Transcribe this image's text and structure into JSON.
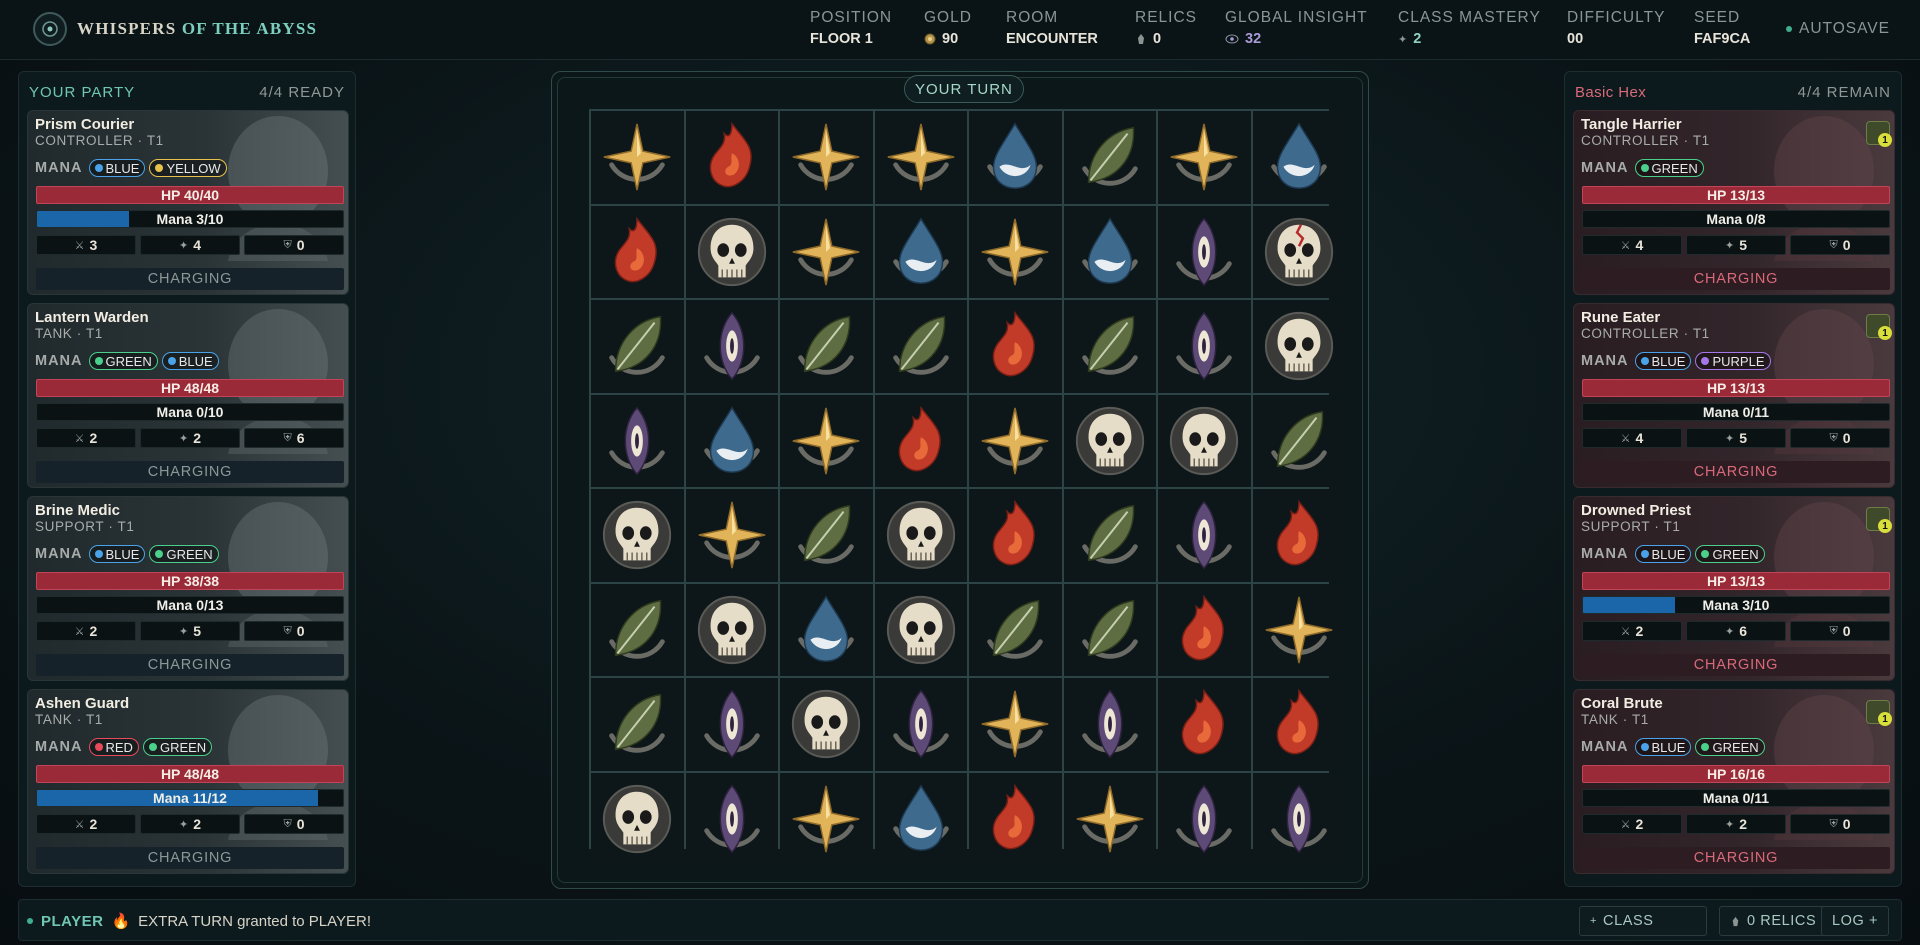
{
  "topbar": {
    "title_main": "WHISPERS",
    "title_accent": "OF THE ABYSS",
    "stats": [
      {
        "label": "POSITION",
        "value": "FLOOR 1"
      },
      {
        "label": "GOLD",
        "value": "90",
        "icon": "coin-icon"
      },
      {
        "label": "ROOM",
        "value": "ENCOUNTER"
      },
      {
        "label": "RELICS",
        "value": "0",
        "icon": "relic-icon"
      },
      {
        "label": "GLOBAL INSIGHT",
        "value": "32",
        "icon": "eye-icon"
      },
      {
        "label": "CLASS MASTERY",
        "value": "2",
        "icon": "mastery-icon"
      },
      {
        "label": "DIFFICULTY",
        "value": "00"
      },
      {
        "label": "SEED",
        "value": "FAF9CA"
      }
    ],
    "autosave": "AUTOSAVE"
  },
  "party": {
    "title": "YOUR PARTY",
    "status": "4/4 READY",
    "members": [
      {
        "name": "Prism Courier",
        "class": "CONTROLLER · T1",
        "mana_label": "MANA",
        "colors": [
          "BLUE",
          "YELLOW"
        ],
        "hp": "HP 40/40",
        "mana": "Mana 3/10",
        "mana_fraction": 0.3,
        "attack": "3",
        "magic": "4",
        "defense": "0",
        "charge": "CHARGING"
      },
      {
        "name": "Lantern Warden",
        "class": "TANK · T1",
        "mana_label": "MANA",
        "colors": [
          "GREEN",
          "BLUE"
        ],
        "hp": "HP 48/48",
        "mana": "Mana 0/10",
        "mana_fraction": 0,
        "attack": "2",
        "magic": "2",
        "defense": "6",
        "charge": "CHARGING"
      },
      {
        "name": "Brine Medic",
        "class": "SUPPORT · T1",
        "mana_label": "MANA",
        "colors": [
          "BLUE",
          "GREEN"
        ],
        "hp": "HP 38/38",
        "mana": "Mana 0/13",
        "mana_fraction": 0,
        "attack": "2",
        "magic": "5",
        "defense": "0",
        "charge": "CHARGING"
      },
      {
        "name": "Ashen Guard",
        "class": "TANK · T1",
        "mana_label": "MANA",
        "colors": [
          "RED",
          "GREEN"
        ],
        "hp": "HP 48/48",
        "mana": "Mana 11/12",
        "mana_fraction": 0.9167,
        "attack": "2",
        "magic": "2",
        "defense": "0",
        "charge": "CHARGING"
      }
    ]
  },
  "enemies": {
    "title": "Basic Hex",
    "status": "4/4 REMAIN",
    "members": [
      {
        "name": "Tangle Harrier",
        "class": "CONTROLLER · T1",
        "mana_label": "MANA",
        "colors": [
          "GREEN"
        ],
        "hp": "HP 13/13",
        "mana": "Mana 0/8",
        "mana_fraction": 0,
        "attack": "4",
        "magic": "5",
        "defense": "0",
        "charge": "CHARGING",
        "badge": "1"
      },
      {
        "name": "Rune Eater",
        "class": "CONTROLLER · T1",
        "mana_label": "MANA",
        "colors": [
          "BLUE",
          "PURPLE"
        ],
        "hp": "HP 13/13",
        "mana": "Mana 0/11",
        "mana_fraction": 0,
        "attack": "4",
        "magic": "5",
        "defense": "0",
        "charge": "CHARGING",
        "badge": "1"
      },
      {
        "name": "Drowned Priest",
        "class": "SUPPORT · T1",
        "mana_label": "MANA",
        "colors": [
          "BLUE",
          "GREEN"
        ],
        "hp": "HP 13/13",
        "mana": "Mana 3/10",
        "mana_fraction": 0.3,
        "attack": "2",
        "magic": "6",
        "defense": "0",
        "charge": "CHARGING",
        "badge": "1"
      },
      {
        "name": "Coral Brute",
        "class": "TANK · T1",
        "mana_label": "MANA",
        "colors": [
          "BLUE",
          "GREEN"
        ],
        "hp": "HP 16/16",
        "mana": "Mana 0/11",
        "mana_fraction": 0,
        "attack": "2",
        "magic": "2",
        "defense": "0",
        "charge": "CHARGING",
        "badge": "1"
      }
    ]
  },
  "board": {
    "turn_label": "YOUR TURN",
    "rows": [
      [
        "star",
        "fire",
        "star",
        "star",
        "water",
        "leaf",
        "star",
        "water"
      ],
      [
        "fire",
        "skull",
        "star",
        "water",
        "star",
        "water",
        "eye",
        "skull-cracked"
      ],
      [
        "leaf",
        "eye",
        "leaf",
        "leaf",
        "fire",
        "leaf",
        "eye",
        "skull"
      ],
      [
        "eye",
        "water",
        "star",
        "fire",
        "star",
        "skull",
        "skull",
        "leaf"
      ],
      [
        "skull",
        "star",
        "leaf",
        "skull",
        "fire",
        "leaf",
        "eye",
        "fire"
      ],
      [
        "leaf",
        "skull",
        "water",
        "skull",
        "leaf",
        "leaf",
        "fire",
        "star"
      ],
      [
        "leaf",
        "eye",
        "skull",
        "eye",
        "star",
        "eye",
        "fire",
        "fire"
      ],
      [
        "skull",
        "eye",
        "star",
        "water",
        "fire",
        "star",
        "eye",
        "eye"
      ]
    ]
  },
  "colors": {
    "BLUE": "#4aa3e8",
    "YELLOW": "#e8c24a",
    "GREEN": "#4ad08a",
    "RED": "#e84a5a",
    "PURPLE": "#a478e8"
  },
  "bottom": {
    "log_actor": "PLAYER",
    "log_message": "EXTRA TURN granted to PLAYER!",
    "class_button": "CLASS",
    "relics_button": "0 RELICS",
    "log_button": "LOG +"
  }
}
